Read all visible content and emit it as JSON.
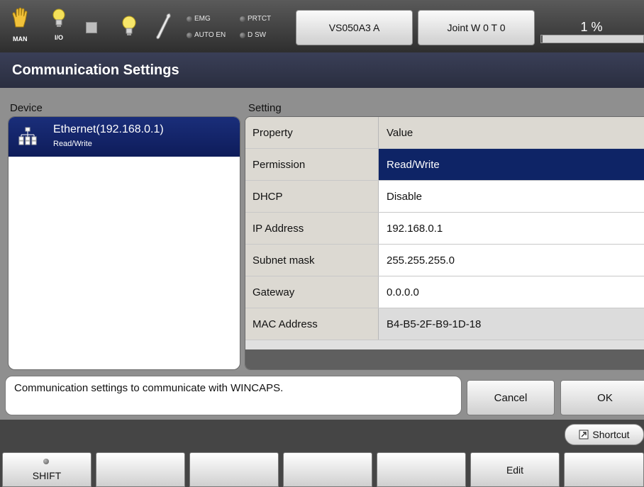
{
  "topbar": {
    "mode_icon": "hand-icon",
    "mode_caption": "MAN",
    "io_icon": "lightbulb-icon",
    "io_caption": "I/O",
    "indicators": [
      {
        "label": "EMG"
      },
      {
        "label": "AUTO EN"
      },
      {
        "label": "PRTCT"
      },
      {
        "label": "D SW"
      }
    ],
    "robot_button": "VS050A3 A",
    "joint_button": "Joint W 0 T 0",
    "speed_text": "1 %",
    "speed_value": 1
  },
  "title": "Communication Settings",
  "device": {
    "header": "Device",
    "items": [
      {
        "name": "Ethernet(192.168.0.1)",
        "permission": "Read/Write",
        "icon": "network-icon"
      }
    ]
  },
  "setting": {
    "header": "Setting",
    "columns": [
      "Property",
      "Value"
    ],
    "rows": [
      {
        "property": "Permission",
        "value": "Read/Write"
      },
      {
        "property": "DHCP",
        "value": "Disable"
      },
      {
        "property": "IP Address",
        "value": "192.168.0.1"
      },
      {
        "property": "Subnet mask",
        "value": "255.255.255.0"
      },
      {
        "property": "Gateway",
        "value": "0.0.0.0"
      },
      {
        "property": "MAC Address",
        "value": "B4-B5-2F-B9-1D-18"
      }
    ]
  },
  "description": "Communication settings to communicate with WINCAPS.",
  "buttons": {
    "cancel": "Cancel",
    "ok": "OK"
  },
  "shortcut": {
    "label": "Shortcut",
    "icon": "shortcut-icon"
  },
  "function_keys": [
    "SHIFT",
    "",
    "",
    "",
    "",
    "Edit",
    ""
  ],
  "colors": {
    "selection": "#0e2466",
    "title_bar": "#2f3347"
  }
}
